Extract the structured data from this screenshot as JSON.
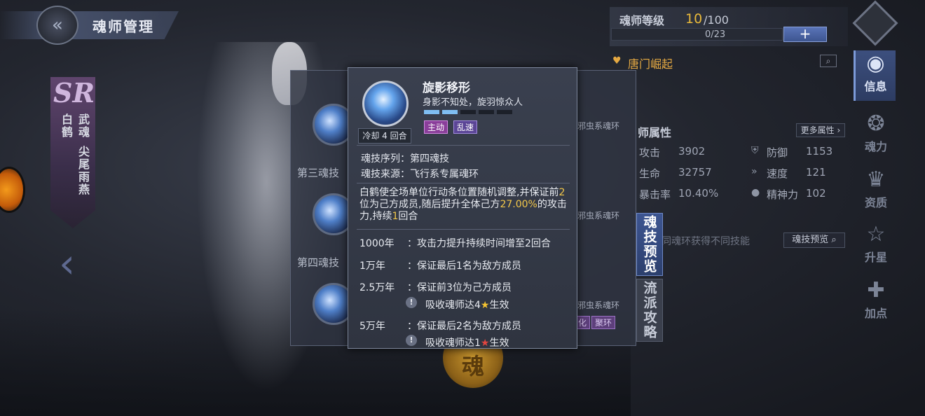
{
  "header": {
    "title": "魂师管理",
    "back_icon": "back-arrow-icon"
  },
  "character": {
    "rarity": "SR",
    "name": "白鹤",
    "martial_soul_label": "武魂",
    "martial_soul": "尖尾雨燕"
  },
  "rank": {
    "label": "魂师等级",
    "current": "10",
    "max": "/100",
    "exp": "0/23",
    "plus": "+"
  },
  "sect": {
    "name": "唐门崛起"
  },
  "attributes": {
    "title": "师属性",
    "more": "更多属性",
    "items": [
      {
        "label": "攻击",
        "value": "3902"
      },
      {
        "label": "防御",
        "value": "1153"
      },
      {
        "label": "生命",
        "value": "32757"
      },
      {
        "label": "速度",
        "value": "121"
      },
      {
        "label": "暴击率",
        "value": "10.40%"
      },
      {
        "label": "精神力",
        "value": "102"
      }
    ]
  },
  "preview": {
    "hint": "同魂环获得不同技能",
    "button": "魂技预览"
  },
  "side_nav": [
    {
      "label": "信息",
      "icon": "info-icon",
      "active": true
    },
    {
      "label": "魂力",
      "icon": "soul-power-icon",
      "active": false
    },
    {
      "label": "资质",
      "icon": "aptitude-icon",
      "active": false
    },
    {
      "label": "升星",
      "icon": "star-up-icon",
      "active": false
    },
    {
      "label": "加点",
      "icon": "add-point-icon",
      "active": false
    }
  ],
  "skill_panel": {
    "rows": [
      {
        "name": "第三魂技",
        "ring": "邪虫系魂环"
      },
      {
        "name": "第四魂技",
        "ring": "邪虫系魂环"
      },
      {
        "name": "",
        "ring": "邪虫系魂环",
        "tags": [
          "化",
          "聚环"
        ]
      }
    ],
    "tabs": {
      "preview": "魂技预览",
      "strategy": "流派攻略"
    },
    "emblem": "魂"
  },
  "tooltip": {
    "name": "旋影移形",
    "subtitle": "身影不知处，旋羽惊众人",
    "cooldown": "冷却 4 回合",
    "level_segments": [
      true,
      true,
      false,
      false,
      false
    ],
    "tags": [
      "主动",
      "乱速"
    ],
    "sequence": "魂技序列：第四魂技",
    "source": "魂技来源：飞行系专属魂环",
    "desc": {
      "p1": "白鹤使全场单位行动条位置随机调整,并保证前",
      "n1": "2",
      "p2": "位为己方成员,随后提升全体己方",
      "n2": "27.00%",
      "p3": "的攻击力,持续",
      "n3": "1",
      "p4": "回合"
    },
    "upgrades": [
      {
        "year": "1000年",
        "effect": "：攻击力提升持续时间增至2回合"
      },
      {
        "year": "1万年",
        "effect": "：保证最后1名为敌方成员"
      },
      {
        "year": "2.5万年",
        "effect": "：保证前3位为己方成员",
        "cond_pre": "吸收魂师达4",
        "cond_post": "生效",
        "star": "yellow"
      },
      {
        "year": "5万年",
        "effect": "：保证最后2名为敌方成员",
        "cond_pre": "吸收魂师达1",
        "cond_post": "生效",
        "star": "red"
      }
    ]
  }
}
